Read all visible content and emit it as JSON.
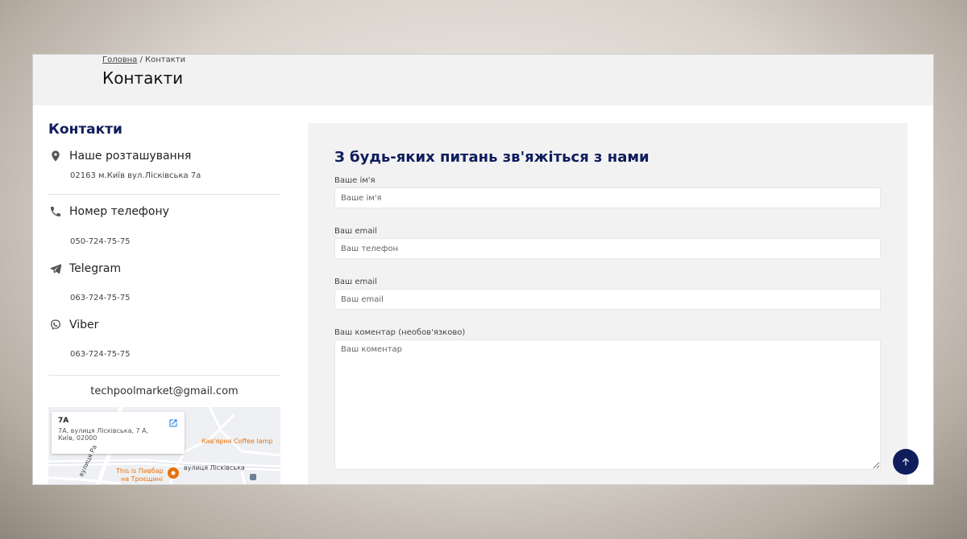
{
  "breadcrumb": {
    "home": "Головна",
    "separator": " / ",
    "current": "Контакти"
  },
  "page_title": "Контакти",
  "contacts": {
    "heading": "Контакти",
    "location": {
      "label": "Наше розташування",
      "value": "02163 м.Київ вул.Лісківська 7а",
      "icon": "location-pin-icon"
    },
    "phone": {
      "label": "Номер телефону",
      "value": "050-724-75-75",
      "icon": "phone-icon"
    },
    "telegram": {
      "label": "Telegram",
      "value": "063-724-75-75",
      "icon": "telegram-icon"
    },
    "viber": {
      "label": "Viber",
      "value": "063-724-75-75",
      "icon": "viber-icon"
    },
    "email": "techpoolmarket@gmail.com"
  },
  "map": {
    "card_title": "7A",
    "card_address_line1": "7A, вулиця Лісківська, 7 A,",
    "card_address_line2": "Київ, 02000",
    "poi_cafe": "Кав'ярня Coffee lamp ",
    "poi_bar_line1": "This is Пивбар",
    "poi_bar_line2": "на Троєщині",
    "street_main": "вулиця Лісківська",
    "street_side": "вулиця Ра"
  },
  "form": {
    "title": "З будь-яких питань зв'яжіться з нами",
    "name_label": "Ваше ім'я",
    "name_placeholder": "Ваше ім'я",
    "phone_label": "Ваш email",
    "phone_placeholder": "Ваш телефон",
    "email_label": "Ваш email",
    "email_placeholder": "Ваш email",
    "comment_label": "Ваш коментар (необов'язково)",
    "comment_placeholder": "Ваш коментар"
  },
  "colors": {
    "accent": "#0f1d5c",
    "panel": "#f2f2f2",
    "poi": "#e8710a"
  }
}
